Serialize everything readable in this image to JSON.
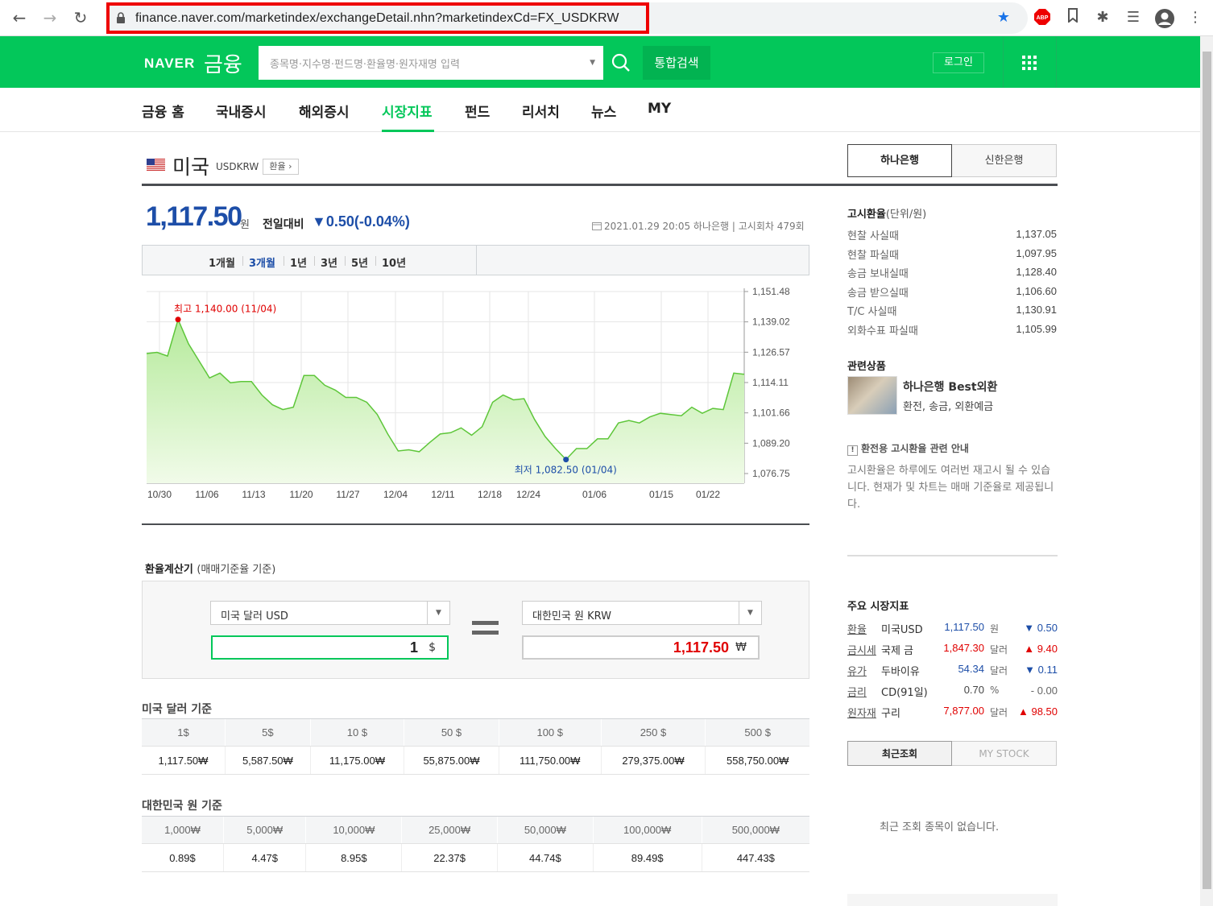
{
  "browser": {
    "url": "finance.naver.com/marketindex/exchangeDetail.nhn?marketindexCd=FX_USDKRW"
  },
  "header": {
    "logo": "NAVER",
    "service": "금융",
    "search_placeholder": "종목명·지수명·펀드명·환율명·원자재명 입력",
    "search_button": "통합검색",
    "login": "로그인"
  },
  "menu": [
    {
      "label": "금융 홈"
    },
    {
      "label": "국내증시"
    },
    {
      "label": "해외증시"
    },
    {
      "label": "시장지표",
      "active": true
    },
    {
      "label": "펀드"
    },
    {
      "label": "리서치"
    },
    {
      "label": "뉴스"
    },
    {
      "label": "MY"
    }
  ],
  "title": {
    "country": "미국",
    "code": "USDKRW",
    "badge": "환율"
  },
  "bank_tabs": [
    "하나은행",
    "신한은행"
  ],
  "quote": {
    "price": "1,117.50",
    "unit": "원",
    "diff_label": "전일대비",
    "diff": "▼0.50(-0.04%)",
    "meta": "2021.01.29 20:05  하나은행  |  고시회차 479회"
  },
  "periods": [
    "1개월",
    "3개월",
    "1년",
    "3년",
    "5년",
    "10년"
  ],
  "chart_data": {
    "type": "area",
    "x": [
      "10/30",
      "11/06",
      "11/13",
      "11/20",
      "11/27",
      "12/04",
      "12/11",
      "12/18",
      "12/24",
      "01/06",
      "01/15",
      "01/22"
    ],
    "y_ticks": [
      "1,151.48",
      "1,139.02",
      "1,126.57",
      "1,114.11",
      "1,101.66",
      "1,089.20",
      "1,076.75"
    ],
    "ylim": [
      1076.75,
      1151.48
    ],
    "values": [
      1126,
      1126.5,
      1125,
      1140,
      1130,
      1123,
      1116,
      1118,
      1114,
      1114.5,
      1114.5,
      1109,
      1105,
      1103,
      1104,
      1117,
      1117,
      1113,
      1111,
      1108,
      1108,
      1106,
      1101,
      1093,
      1086,
      1086.5,
      1085.7,
      1089.5,
      1093,
      1093.5,
      1095.5,
      1092.5,
      1096,
      1106,
      1109,
      1107,
      1107.5,
      1099,
      1092,
      1087,
      1082.5,
      1087,
      1087,
      1091,
      1091,
      1097.5,
      1098.5,
      1097.5,
      1100,
      1101.5,
      1101,
      1100.5,
      1104,
      1101.5,
      1103.5,
      1103,
      1118,
      1117.5
    ],
    "annotations": [
      {
        "label": "최고 1,140.00 (11/04)",
        "index": 3,
        "color": "#e00000"
      },
      {
        "label": "최저 1,082.50 (01/04)",
        "index": 40,
        "color": "#1d4ea8"
      }
    ],
    "colors": {
      "line": "#5ec63a",
      "fill_top": "#b5ea9b",
      "fill_bottom": "#f1fbe9",
      "grid": "#e6e6e6"
    }
  },
  "rates": {
    "title": "고시환율",
    "unit": "(단위/원)",
    "rows": [
      {
        "label": "현찰 사실때",
        "value": "1,137.05"
      },
      {
        "label": "현찰 파실때",
        "value": "1,097.95"
      },
      {
        "label": "송금 보내실때",
        "value": "1,128.40"
      },
      {
        "label": "송금 받으실때",
        "value": "1,106.60"
      },
      {
        "label": "T/C 사실때",
        "value": "1,130.91"
      },
      {
        "label": "외화수표 파실때",
        "value": "1,105.99"
      }
    ]
  },
  "related": {
    "title": "관련상품",
    "name": "하나은행 Best외환",
    "desc": "환전, 송금, 외환예금"
  },
  "notice": {
    "title": "환전용 고시환율 관련 안내",
    "body": "고시환율은 하루에도 여러번 재고시 될 수 있습니다. 현재가 및 차트는 매매 기준율로 제공됩니다."
  },
  "market": {
    "title": "주요 시장지표",
    "rows": [
      {
        "cat": "환율",
        "name": "미국USD",
        "value": "1,117.50",
        "unit": "원",
        "change": "▼ 0.50",
        "dir": "down"
      },
      {
        "cat": "금시세",
        "name": "국제 금",
        "value": "1,847.30",
        "unit": "달러",
        "change": "▲ 9.40",
        "dir": "up"
      },
      {
        "cat": "유가",
        "name": "두바이유",
        "value": "54.34",
        "unit": "달러",
        "change": "▼ 0.11",
        "dir": "down"
      },
      {
        "cat": "금리",
        "name": "CD(91일)",
        "value": "0.70",
        "unit": "%",
        "change": "- 0.00",
        "dir": "flat"
      },
      {
        "cat": "원자재",
        "name": "구리",
        "value": "7,877.00",
        "unit": "달러",
        "change": "▲ 98.50",
        "dir": "up"
      }
    ],
    "colors": {
      "up": "#e00000",
      "down": "#1d4ea8",
      "flat": "#666666"
    }
  },
  "recent": {
    "tabs": [
      "최근조회",
      "MY STOCK"
    ],
    "empty": "최근 조회 종목이 없습니다."
  },
  "calculator": {
    "title": "환율계산기",
    "subtitle": "(매매기준율 기준)",
    "from_currency": "미국 달러 USD",
    "to_currency": "대한민국 원 KRW",
    "from_value": "1",
    "from_unit": "$",
    "to_value": "1,117.50",
    "to_unit": "₩"
  },
  "usd_table": {
    "title": "미국 달러 기준",
    "headers": [
      "1$",
      "5$",
      "10 $",
      "50 $",
      "100 $",
      "250 $",
      "500 $"
    ],
    "values": [
      "1,117.50₩",
      "5,587.50₩",
      "11,175.00₩",
      "55,875.00₩",
      "111,750.00₩",
      "279,375.00₩",
      "558,750.00₩"
    ]
  },
  "krw_table": {
    "title": "대한민국 원 기준",
    "headers": [
      "1,000₩",
      "5,000₩",
      "10,000₩",
      "25,000₩",
      "50,000₩",
      "100,000₩",
      "500,000₩"
    ],
    "values": [
      "0.89$",
      "4.47$",
      "8.95$",
      "22.37$",
      "44.74$",
      "89.49$",
      "447.43$"
    ]
  }
}
